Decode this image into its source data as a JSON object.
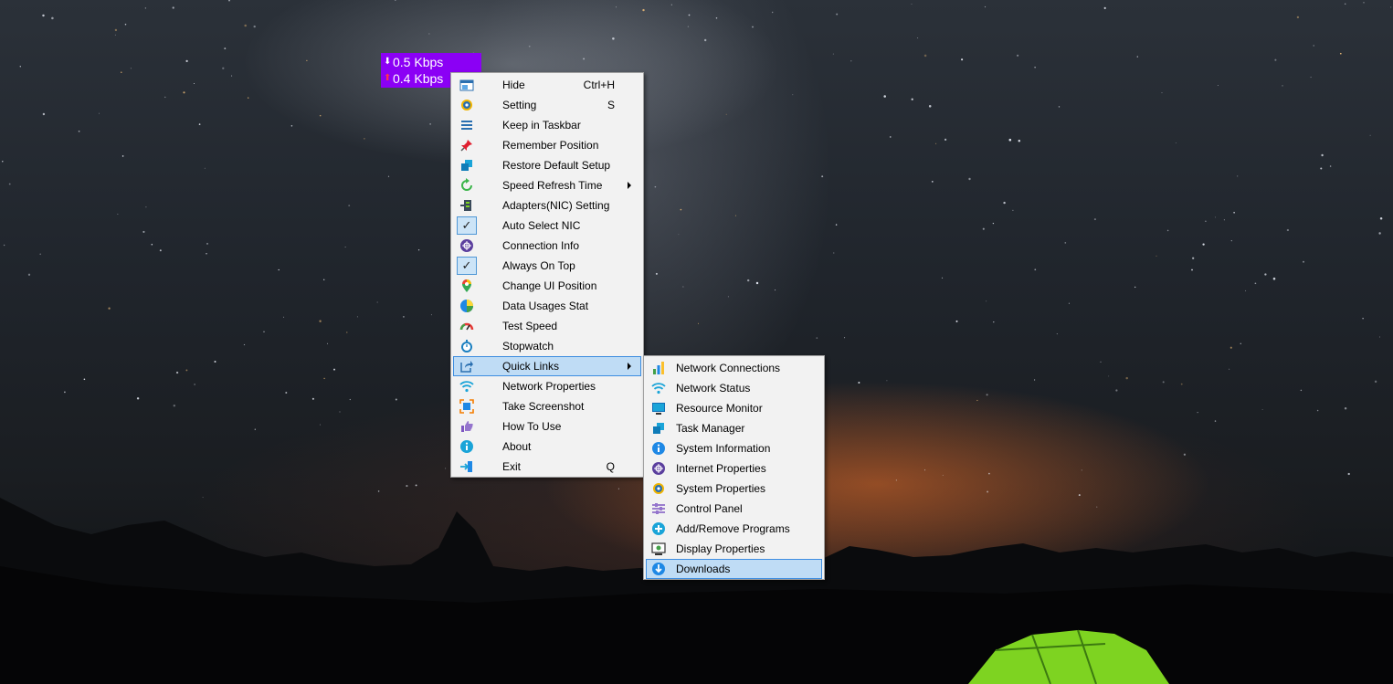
{
  "speed": {
    "download_arrow": "⬇",
    "download": "0.5 Kbps",
    "upload_arrow": "⬆",
    "upload": "0.4 Kbps",
    "widget_color": "#8b00f5"
  },
  "main_menu": {
    "hide": {
      "label": "Hide",
      "shortcut": "Ctrl+H",
      "icon": "window-icon"
    },
    "setting": {
      "label": "Setting",
      "shortcut": "S",
      "icon": "gear-icon"
    },
    "keep_taskbar": {
      "label": "Keep in Taskbar",
      "icon": "taskbar-icon"
    },
    "remember_position": {
      "label": "Remember Position",
      "icon": "pin-icon"
    },
    "restore_default": {
      "label": "Restore Default Setup",
      "icon": "restore-icon"
    },
    "speed_refresh": {
      "label": "Speed Refresh Time",
      "icon": "refresh-icon"
    },
    "adapters_setting": {
      "label": "Adapters(NIC) Setting",
      "icon": "adapter-icon"
    },
    "auto_select": {
      "label": "Auto Select NIC",
      "icon": "check-icon",
      "checked": true
    },
    "connection_info": {
      "label": "Connection Info",
      "icon": "connection-icon"
    },
    "always_on_top": {
      "label": "Always On Top",
      "icon": "check-icon",
      "checked": true
    },
    "change_ui": {
      "label": "Change UI Position",
      "icon": "location-icon"
    },
    "data_usage": {
      "label": "Data Usages Stat",
      "icon": "pie-chart-icon"
    },
    "test_speed": {
      "label": "Test Speed",
      "icon": "speedometer-icon"
    },
    "stopwatch": {
      "label": "Stopwatch",
      "icon": "stopwatch-icon"
    },
    "quick_links": {
      "label": "Quick Links",
      "icon": "share-icon",
      "highlighted": true
    },
    "network_properties": {
      "label": "Network Properties",
      "icon": "wifi-icon"
    },
    "take_screenshot": {
      "label": "Take Screenshot",
      "icon": "screenshot-icon"
    },
    "how_to_use": {
      "label": "How To Use",
      "icon": "hand-icon"
    },
    "about": {
      "label": "About",
      "icon": "info-icon"
    },
    "exit": {
      "label": "Exit",
      "shortcut": "Q",
      "icon": "exit-icon"
    }
  },
  "sub_menu": {
    "network_connections": {
      "label": "Network Connections",
      "icon": "bar-chart-icon"
    },
    "network_status": {
      "label": "Network Status",
      "icon": "wifi-icon"
    },
    "resource_monitor": {
      "label": "Resource Monitor",
      "icon": "monitor-icon"
    },
    "task_manager": {
      "label": "Task Manager",
      "icon": "task-manager-icon"
    },
    "system_information": {
      "label": "System Information",
      "icon": "info-icon"
    },
    "internet_properties": {
      "label": "Internet Properties",
      "icon": "connection-icon"
    },
    "system_properties": {
      "label": "System Properties",
      "icon": "gear-icon"
    },
    "control_panel": {
      "label": "Control Panel",
      "icon": "sliders-icon"
    },
    "add_remove": {
      "label": "Add/Remove Programs",
      "icon": "plus-icon"
    },
    "display_properties": {
      "label": "Display Properties",
      "icon": "display-icon"
    },
    "downloads": {
      "label": "Downloads",
      "icon": "download-icon",
      "highlighted": true
    }
  },
  "colors": {
    "menu_bg": "#f2f2f2",
    "highlight_bg": "#bfdcf5",
    "highlight_border": "#3d8de0"
  }
}
